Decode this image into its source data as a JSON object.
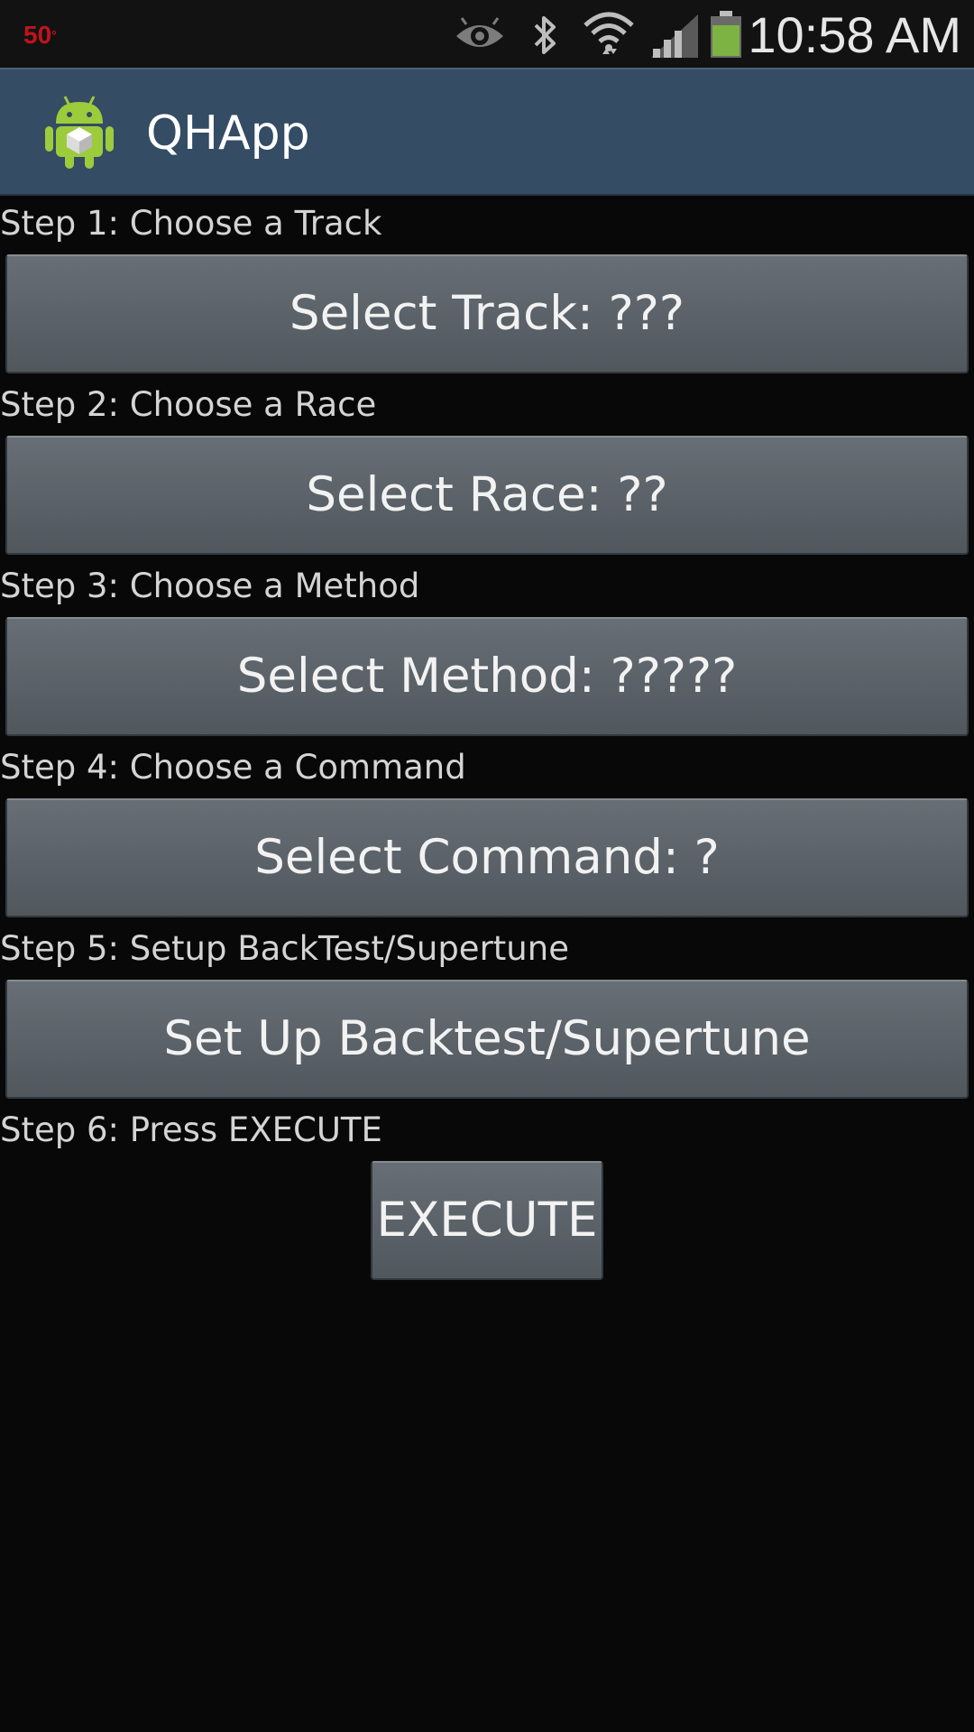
{
  "status_bar": {
    "temperature": "50",
    "temperature_unit": "°",
    "icons": [
      "eye-icon",
      "bluetooth-icon",
      "wifi-icon",
      "signal-icon",
      "battery-icon"
    ],
    "time": "10:58 AM",
    "battery_color": "#7cb342"
  },
  "action_bar": {
    "title": "QHApp",
    "icon": "android-app-icon",
    "background": "#344c64"
  },
  "steps": [
    {
      "label": "Step 1: Choose a Track",
      "button": "Select Track: ???"
    },
    {
      "label": "Step 2: Choose a Race",
      "button": "Select Race: ??"
    },
    {
      "label": "Step 3: Choose a Method",
      "button": "Select Method: ?????"
    },
    {
      "label": "Step 4: Choose a Command",
      "button": "Select Command: ?"
    },
    {
      "label": "Step 5: Setup BackTest/Supertune",
      "button": "Set Up Backtest/Supertune"
    },
    {
      "label": "Step 6: Press EXECUTE",
      "button": "EXECUTE"
    }
  ]
}
